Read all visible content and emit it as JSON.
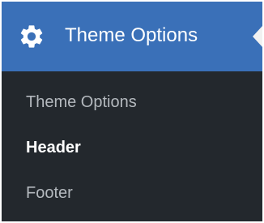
{
  "menu": {
    "title": "Theme Options",
    "icon": "gear-icon",
    "colors": {
      "header_bg": "#3a70b8",
      "menu_bg": "#23282d",
      "current_text": "#ffffff",
      "item_text": "#b4b9be"
    },
    "items": [
      {
        "label": "Theme Options",
        "current": false
      },
      {
        "label": "Header",
        "current": true
      },
      {
        "label": "Footer",
        "current": false
      }
    ]
  }
}
